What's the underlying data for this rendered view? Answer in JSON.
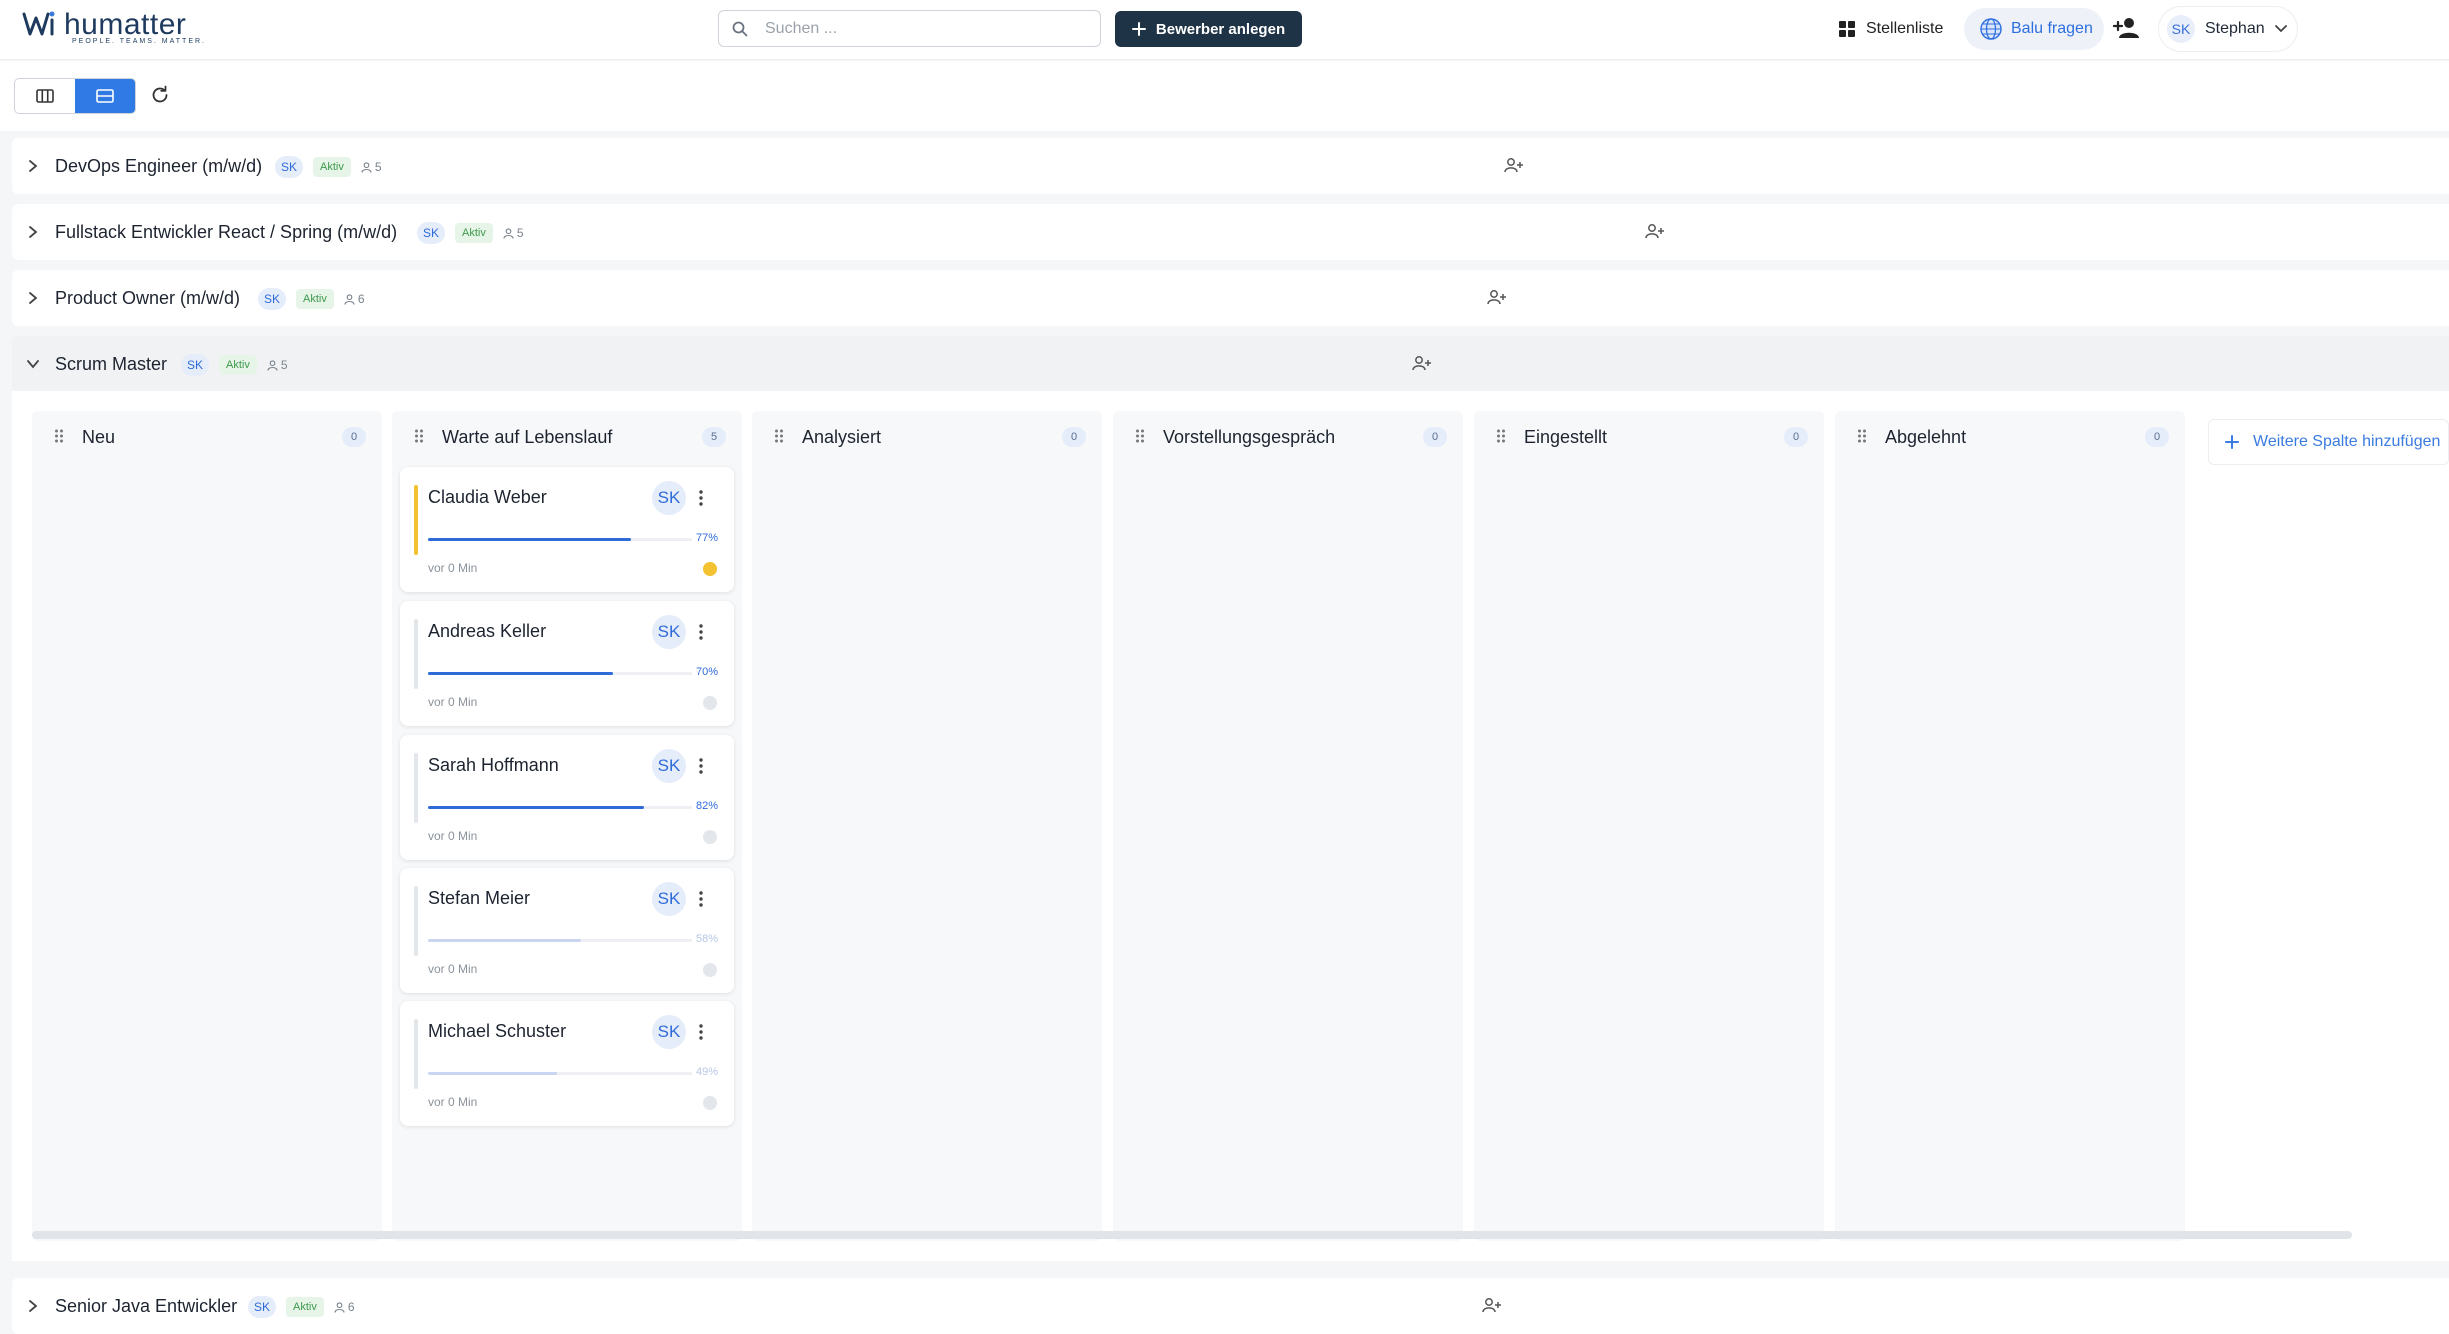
{
  "header": {
    "logo_text": "humatter",
    "logo_tagline": "PEOPLE. TEAMS. MATTER.",
    "search_placeholder": "Suchen ...",
    "create_button": "Bewerber anlegen",
    "nav_jobs": "Stellenliste",
    "ask_button": "Balu fragen",
    "user_initials": "SK",
    "user_name": "Stephan"
  },
  "jobs": [
    {
      "title": "DevOps Engineer (m/w/d)",
      "owner": "SK",
      "status": "Aktiv",
      "count": "5"
    },
    {
      "title": "Fullstack Entwickler React / Spring (m/w/d)",
      "owner": "SK",
      "status": "Aktiv",
      "count": "5"
    },
    {
      "title": "Product Owner (m/w/d)",
      "owner": "SK",
      "status": "Aktiv",
      "count": "6"
    },
    {
      "title": "Scrum Master",
      "owner": "SK",
      "status": "Aktiv",
      "count": "5"
    },
    {
      "title": "Senior Java Entwickler",
      "owner": "SK",
      "status": "Aktiv",
      "count": "6"
    }
  ],
  "board": {
    "columns": [
      {
        "name": "Neu",
        "count": "0"
      },
      {
        "name": "Warte auf Lebenslauf",
        "count": "5"
      },
      {
        "name": "Analysiert",
        "count": "0"
      },
      {
        "name": "Vorstellungsgespräch",
        "count": "0"
      },
      {
        "name": "Eingestellt",
        "count": "0"
      },
      {
        "name": "Abgelehnt",
        "count": "0"
      }
    ],
    "add_column": "Weitere Spalte hinzufügen",
    "cards": [
      {
        "name": "Claudia Weber",
        "initials": "SK",
        "score": 77,
        "score_label": "77%",
        "time": "vor 0 Min",
        "status_color": "#f2c230"
      },
      {
        "name": "Andreas Keller",
        "initials": "SK",
        "score": 70,
        "score_label": "70%",
        "time": "vor 0 Min",
        "status_color": "#e3e6ea"
      },
      {
        "name": "Sarah Hoffmann",
        "initials": "SK",
        "score": 82,
        "score_label": "82%",
        "time": "vor 0 Min",
        "status_color": "#e3e6ea"
      },
      {
        "name": "Stefan Meier",
        "initials": "SK",
        "score": 58,
        "score_label": "58%",
        "time": "vor 0 Min",
        "status_color": "#e3e6ea"
      },
      {
        "name": "Michael Schuster",
        "initials": "SK",
        "score": 49,
        "score_label": "49%",
        "time": "vor 0 Min",
        "status_color": "#e3e6ea"
      }
    ]
  },
  "colors": {
    "primary_button": "#1f3347",
    "accent": "#2f7ae5",
    "active_badge": "#3d9a4b"
  }
}
